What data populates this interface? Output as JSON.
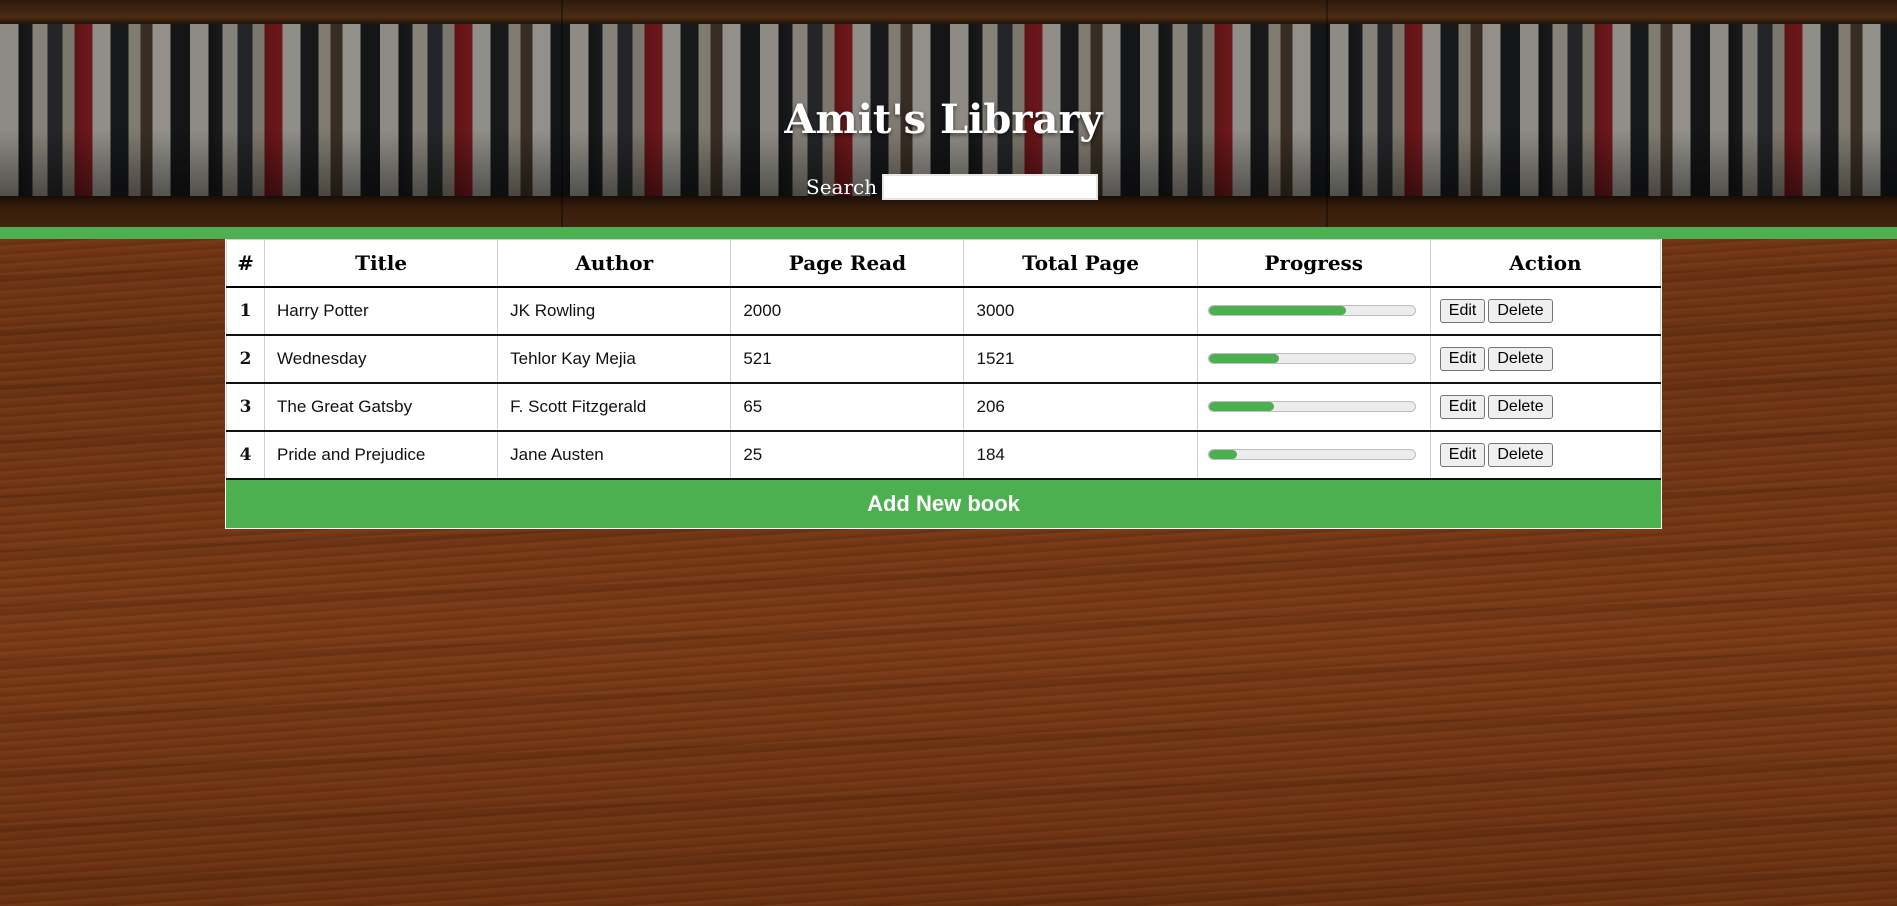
{
  "header": {
    "title": "Amit's Library",
    "search_label": "Search",
    "search_value": "",
    "search_placeholder": ""
  },
  "table": {
    "columns": [
      "#",
      "Title",
      "Author",
      "Page Read",
      "Total Page",
      "Progress",
      "Action"
    ],
    "rows": [
      {
        "num": "1",
        "title": "Harry Potter",
        "author": "JK Rowling",
        "page_read": "2000",
        "total_page": "3000",
        "progress": 0.667
      },
      {
        "num": "2",
        "title": "Wednesday",
        "author": "Tehlor Kay Mejia",
        "page_read": "521",
        "total_page": "1521",
        "progress": 0.343
      },
      {
        "num": "3",
        "title": "The Great Gatsby",
        "author": "F. Scott Fitzgerald",
        "page_read": "65",
        "total_page": "206",
        "progress": 0.316
      },
      {
        "num": "4",
        "title": "Pride and Prejudice",
        "author": "Jane Austen",
        "page_read": "25",
        "total_page": "184",
        "progress": 0.136
      }
    ],
    "edit_label": "Edit",
    "delete_label": "Delete",
    "add_label": "Add New book"
  },
  "colors": {
    "accent_green": "#4caf50",
    "header_text": "#ffffff"
  }
}
